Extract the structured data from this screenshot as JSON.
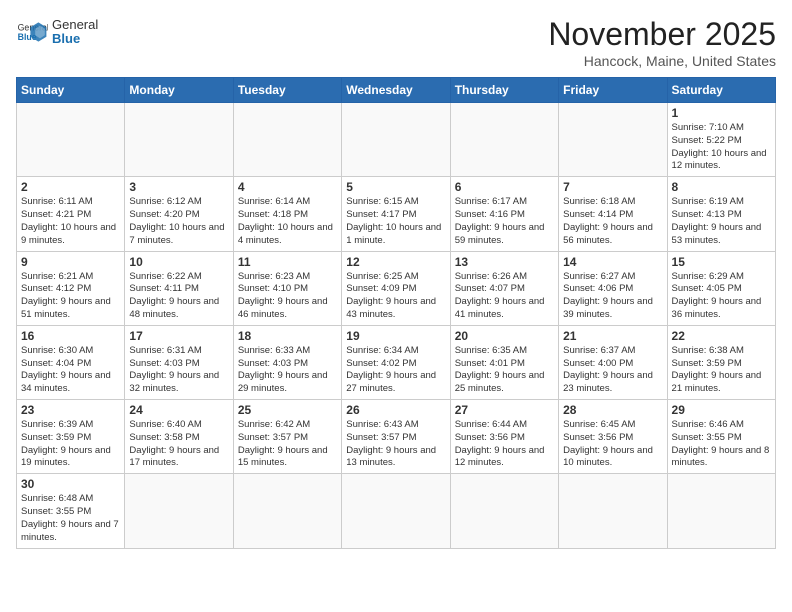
{
  "header": {
    "logo_general": "General",
    "logo_blue": "Blue",
    "title": "November 2025",
    "subtitle": "Hancock, Maine, United States"
  },
  "days_of_week": [
    "Sunday",
    "Monday",
    "Tuesday",
    "Wednesday",
    "Thursday",
    "Friday",
    "Saturday"
  ],
  "weeks": [
    [
      {
        "day": "",
        "info": ""
      },
      {
        "day": "",
        "info": ""
      },
      {
        "day": "",
        "info": ""
      },
      {
        "day": "",
        "info": ""
      },
      {
        "day": "",
        "info": ""
      },
      {
        "day": "",
        "info": ""
      },
      {
        "day": "1",
        "info": "Sunrise: 7:10 AM\nSunset: 5:22 PM\nDaylight: 10 hours and 12 minutes."
      }
    ],
    [
      {
        "day": "2",
        "info": "Sunrise: 6:11 AM\nSunset: 4:21 PM\nDaylight: 10 hours and 9 minutes."
      },
      {
        "day": "3",
        "info": "Sunrise: 6:12 AM\nSunset: 4:20 PM\nDaylight: 10 hours and 7 minutes."
      },
      {
        "day": "4",
        "info": "Sunrise: 6:14 AM\nSunset: 4:18 PM\nDaylight: 10 hours and 4 minutes."
      },
      {
        "day": "5",
        "info": "Sunrise: 6:15 AM\nSunset: 4:17 PM\nDaylight: 10 hours and 1 minute."
      },
      {
        "day": "6",
        "info": "Sunrise: 6:17 AM\nSunset: 4:16 PM\nDaylight: 9 hours and 59 minutes."
      },
      {
        "day": "7",
        "info": "Sunrise: 6:18 AM\nSunset: 4:14 PM\nDaylight: 9 hours and 56 minutes."
      },
      {
        "day": "8",
        "info": "Sunrise: 6:19 AM\nSunset: 4:13 PM\nDaylight: 9 hours and 53 minutes."
      }
    ],
    [
      {
        "day": "9",
        "info": "Sunrise: 6:21 AM\nSunset: 4:12 PM\nDaylight: 9 hours and 51 minutes."
      },
      {
        "day": "10",
        "info": "Sunrise: 6:22 AM\nSunset: 4:11 PM\nDaylight: 9 hours and 48 minutes."
      },
      {
        "day": "11",
        "info": "Sunrise: 6:23 AM\nSunset: 4:10 PM\nDaylight: 9 hours and 46 minutes."
      },
      {
        "day": "12",
        "info": "Sunrise: 6:25 AM\nSunset: 4:09 PM\nDaylight: 9 hours and 43 minutes."
      },
      {
        "day": "13",
        "info": "Sunrise: 6:26 AM\nSunset: 4:07 PM\nDaylight: 9 hours and 41 minutes."
      },
      {
        "day": "14",
        "info": "Sunrise: 6:27 AM\nSunset: 4:06 PM\nDaylight: 9 hours and 39 minutes."
      },
      {
        "day": "15",
        "info": "Sunrise: 6:29 AM\nSunset: 4:05 PM\nDaylight: 9 hours and 36 minutes."
      }
    ],
    [
      {
        "day": "16",
        "info": "Sunrise: 6:30 AM\nSunset: 4:04 PM\nDaylight: 9 hours and 34 minutes."
      },
      {
        "day": "17",
        "info": "Sunrise: 6:31 AM\nSunset: 4:03 PM\nDaylight: 9 hours and 32 minutes."
      },
      {
        "day": "18",
        "info": "Sunrise: 6:33 AM\nSunset: 4:03 PM\nDaylight: 9 hours and 29 minutes."
      },
      {
        "day": "19",
        "info": "Sunrise: 6:34 AM\nSunset: 4:02 PM\nDaylight: 9 hours and 27 minutes."
      },
      {
        "day": "20",
        "info": "Sunrise: 6:35 AM\nSunset: 4:01 PM\nDaylight: 9 hours and 25 minutes."
      },
      {
        "day": "21",
        "info": "Sunrise: 6:37 AM\nSunset: 4:00 PM\nDaylight: 9 hours and 23 minutes."
      },
      {
        "day": "22",
        "info": "Sunrise: 6:38 AM\nSunset: 3:59 PM\nDaylight: 9 hours and 21 minutes."
      }
    ],
    [
      {
        "day": "23",
        "info": "Sunrise: 6:39 AM\nSunset: 3:59 PM\nDaylight: 9 hours and 19 minutes."
      },
      {
        "day": "24",
        "info": "Sunrise: 6:40 AM\nSunset: 3:58 PM\nDaylight: 9 hours and 17 minutes."
      },
      {
        "day": "25",
        "info": "Sunrise: 6:42 AM\nSunset: 3:57 PM\nDaylight: 9 hours and 15 minutes."
      },
      {
        "day": "26",
        "info": "Sunrise: 6:43 AM\nSunset: 3:57 PM\nDaylight: 9 hours and 13 minutes."
      },
      {
        "day": "27",
        "info": "Sunrise: 6:44 AM\nSunset: 3:56 PM\nDaylight: 9 hours and 12 minutes."
      },
      {
        "day": "28",
        "info": "Sunrise: 6:45 AM\nSunset: 3:56 PM\nDaylight: 9 hours and 10 minutes."
      },
      {
        "day": "29",
        "info": "Sunrise: 6:46 AM\nSunset: 3:55 PM\nDaylight: 9 hours and 8 minutes."
      }
    ],
    [
      {
        "day": "30",
        "info": "Sunrise: 6:48 AM\nSunset: 3:55 PM\nDaylight: 9 hours and 7 minutes."
      },
      {
        "day": "",
        "info": ""
      },
      {
        "day": "",
        "info": ""
      },
      {
        "day": "",
        "info": ""
      },
      {
        "day": "",
        "info": ""
      },
      {
        "day": "",
        "info": ""
      },
      {
        "day": "",
        "info": ""
      }
    ]
  ]
}
